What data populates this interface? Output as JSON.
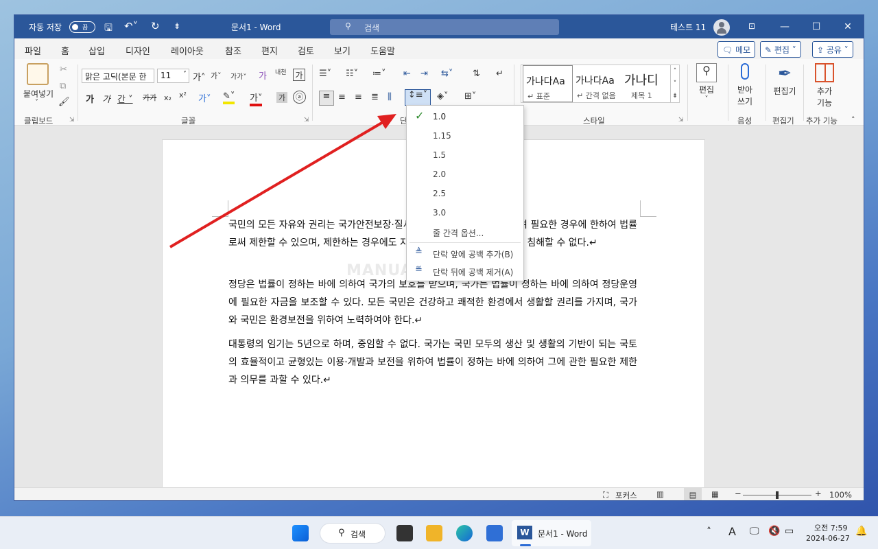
{
  "titlebar": {
    "autosave_label": "자동 저장",
    "autosave_state": "끔",
    "doc_title": "문서1  -  Word",
    "search_placeholder": "검색",
    "user_name": "테스트 11"
  },
  "tabs": [
    "파일",
    "홈",
    "삽입",
    "디자인",
    "레이아웃",
    "참조",
    "편지",
    "검토",
    "보기",
    "도움말"
  ],
  "active_tab": "홈",
  "top_buttons": {
    "memo": "메모",
    "edit": "편집",
    "share": "공유"
  },
  "ribbon": {
    "clipboard": {
      "paste": "붙여넣기",
      "group": "클립보드"
    },
    "font": {
      "name": "맑은 고딕(본문 한",
      "size": "11",
      "group": "글꼴"
    },
    "paragraph": {
      "group": "단락"
    },
    "styles": {
      "group": "스타일",
      "items": [
        {
          "preview": "가나다Aa",
          "name": "↵ 표준"
        },
        {
          "preview": "가나다Aa",
          "name": "↵ 간격 없음"
        },
        {
          "preview": "가나디",
          "name": "제목 1"
        }
      ]
    },
    "editing": {
      "label": "편집",
      "group": ""
    },
    "voice": {
      "dictate_line1": "받아",
      "dictate_line2": "쓰기",
      "group": "음성"
    },
    "editor": {
      "label": "편집기",
      "group": "편집기"
    },
    "addins": {
      "line1": "추가",
      "line2": "기능",
      "group": "추가 기능"
    }
  },
  "line_spacing_menu": {
    "options": [
      "1.0",
      "1.15",
      "1.5",
      "2.0",
      "2.5",
      "3.0"
    ],
    "selected": "1.0",
    "line_options": "줄 간격 옵션...",
    "add_before": "단락 앞에 공백 추가(B)",
    "remove_after": "단락 뒤에 공백 제거(A)"
  },
  "document": {
    "paragraphs": [
      "국민의 모든 자유와 권리는 국가안전보장·질서유지 또는 공공복리를 위하여 필요한 경우에 한하여 법률로써 제한할 수 있으며, 제한하는 경우에도 자유와 권리의 본질적인 내용을 침해할 수 없다.↵",
      "정당은 법률이 정하는 바에 의하여 국가의 보호를 받으며, 국가는 법률이 정하는 바에 의하여 정당운영에 필요한 자금을 보조할 수 있다. 모든 국민은 건강하고 쾌적한 환경에서 생활할 권리를 가지며, 국가와 국민은 환경보전을 위하여 노력하여야 한다.↵",
      "대통령의 임기는 5년으로 하며, 중임할 수 없다. 국가는 국민 모두의 생산 및 생활의 기반이 되는 국토의 효율적이고 균형있는 이용·개발과 보전을 위하여 법률이 정하는 바에 의하여 그에 관한 필요한 제한과 의무를 과할 수 있다.↵"
    ],
    "watermark": "MANUALFACTORY"
  },
  "statusbar": {
    "focus": "포커스",
    "zoom": "100%",
    "zoom_level": 1.0
  },
  "taskbar": {
    "search": "검색",
    "word_app": "문서1 - Word",
    "time": "오전 7:59",
    "date": "2024-06-27"
  },
  "colors": {
    "word_blue": "#2b579a",
    "arrow_red": "#e02020",
    "check_green": "#2e8b2e"
  }
}
